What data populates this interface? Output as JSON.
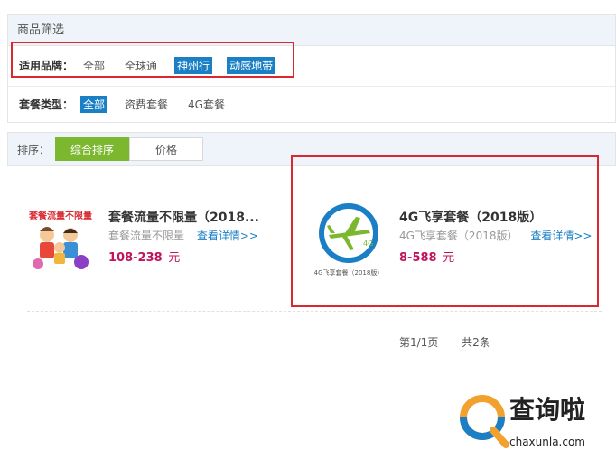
{
  "filter": {
    "header": "商品筛选",
    "brand": {
      "label": "适用品牌：",
      "options": [
        "全部",
        "全球通",
        "神州行",
        "动感地带"
      ],
      "selected": [
        "神州行",
        "动感地带"
      ]
    },
    "package_type": {
      "label": "套餐类型：",
      "options": [
        "全部",
        "资费套餐",
        "4G套餐"
      ],
      "selected": [
        "全部"
      ]
    }
  },
  "sort": {
    "label": "排序：",
    "buttons": [
      "综合排序",
      "价格"
    ],
    "active": "综合排序"
  },
  "products": [
    {
      "image_text": "套餐流量不限量",
      "title": "套餐流量不限量（2018...",
      "subtitle": "套餐流量不限量",
      "detail_link": "查看详情>>",
      "price": "108-238",
      "unit": "元"
    },
    {
      "image_text": "4G飞享套餐（2018版）",
      "image_badge": "4G",
      "title": "4G飞享套餐（2018版）",
      "subtitle": "4G飞享套餐（2018版）",
      "detail_link": "查看详情>>",
      "price": "8-588",
      "unit": "元"
    }
  ],
  "pagination": {
    "page": "第1/1页",
    "total": "共2条"
  },
  "watermark": {
    "name": "查询啦",
    "url": "chaxunla.com"
  },
  "colors": {
    "accent_blue": "#1a7fc4",
    "sort_active_green": "#7cb82f",
    "price_red": "#c0145c",
    "highlight_box_red": "#d9282f"
  }
}
